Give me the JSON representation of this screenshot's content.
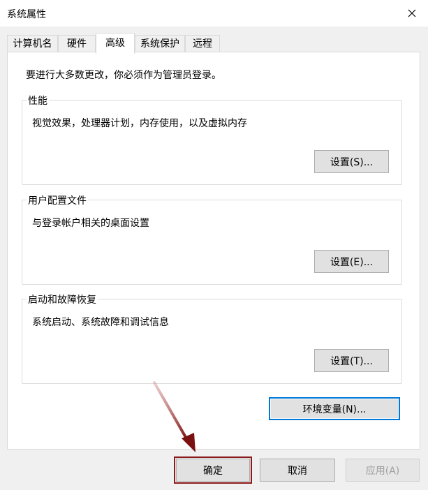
{
  "window": {
    "title": "系统属性"
  },
  "tabs": [
    {
      "label": "计算机名"
    },
    {
      "label": "硬件"
    },
    {
      "label": "高级"
    },
    {
      "label": "系统保护"
    },
    {
      "label": "远程"
    }
  ],
  "panel": {
    "notice": "要进行大多数更改，你必须作为管理员登录。",
    "performance": {
      "title": "性能",
      "desc": "视觉效果，处理器计划，内存使用，以及虚拟内存",
      "button": "设置(S)..."
    },
    "profiles": {
      "title": "用户配置文件",
      "desc": "与登录帐户相关的桌面设置",
      "button": "设置(E)..."
    },
    "startup": {
      "title": "启动和故障恢复",
      "desc": "系统启动、系统故障和调试信息",
      "button": "设置(T)..."
    },
    "env_button": "环境变量(N)..."
  },
  "footer": {
    "ok": "确定",
    "cancel": "取消",
    "apply": "应用(A)"
  },
  "colors": {
    "focus_border": "#0078d7",
    "annotation": "#8b1a1a"
  }
}
